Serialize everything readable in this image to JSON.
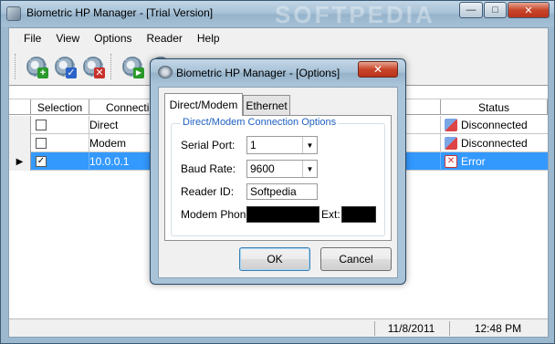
{
  "app": {
    "title": "Biometric HP Manager - [Trial Version]",
    "watermark": "SOFTPEDIA"
  },
  "window_controls": {
    "minimize": "—",
    "maximize": "□",
    "close": "✕"
  },
  "menu": [
    {
      "label": "File"
    },
    {
      "label": "View"
    },
    {
      "label": "Options"
    },
    {
      "label": "Reader"
    },
    {
      "label": "Help"
    }
  ],
  "toolbar": {
    "buttons": [
      {
        "icon": "add-reader-icon",
        "badge": "+",
        "badge_color": "#2a9a2a"
      },
      {
        "icon": "check-reader-icon",
        "badge": "✓",
        "badge_color": "#2b62c9"
      },
      {
        "icon": "remove-reader-icon",
        "badge": "✕",
        "badge_color": "#c9302b"
      },
      {
        "icon": "connect-icon",
        "badge": "▶",
        "badge_color": "#2a9a2a"
      },
      {
        "icon": "settings-icon",
        "badge": "",
        "badge_color": ""
      }
    ]
  },
  "grid": {
    "columns": [
      "Selection",
      "Connection",
      "Status"
    ],
    "rows": [
      {
        "checked": false,
        "connection": "Direct",
        "status": "Disconnected",
        "status_type": "disconnected",
        "selected": false
      },
      {
        "checked": false,
        "connection": "Modem",
        "status": "Disconnected",
        "status_type": "disconnected",
        "selected": false
      },
      {
        "checked": true,
        "connection": "10.0.0.1",
        "status": "Error",
        "status_type": "error",
        "selected": true
      }
    ]
  },
  "statusbar": {
    "date": "11/8/2011",
    "time": "12:48 PM"
  },
  "dialog": {
    "title": "Biometric HP Manager - [Options]",
    "close": "✕",
    "tabs": [
      {
        "label": "Direct/Modem",
        "active": true
      },
      {
        "label": "Ethernet",
        "active": false
      }
    ],
    "group_title": "Direct/Modem Connection Options",
    "fields": {
      "serial_port": {
        "label": "Serial Port:",
        "value": "1"
      },
      "baud_rate": {
        "label": "Baud Rate:",
        "value": "9600"
      },
      "reader_id": {
        "label": "Reader ID:",
        "value": "Softpedia"
      },
      "modem_phone": {
        "label": "Modem Phone:",
        "value": ""
      },
      "ext": {
        "label": "Ext:",
        "value": ""
      }
    },
    "ok_label": "OK",
    "cancel_label": "Cancel"
  }
}
